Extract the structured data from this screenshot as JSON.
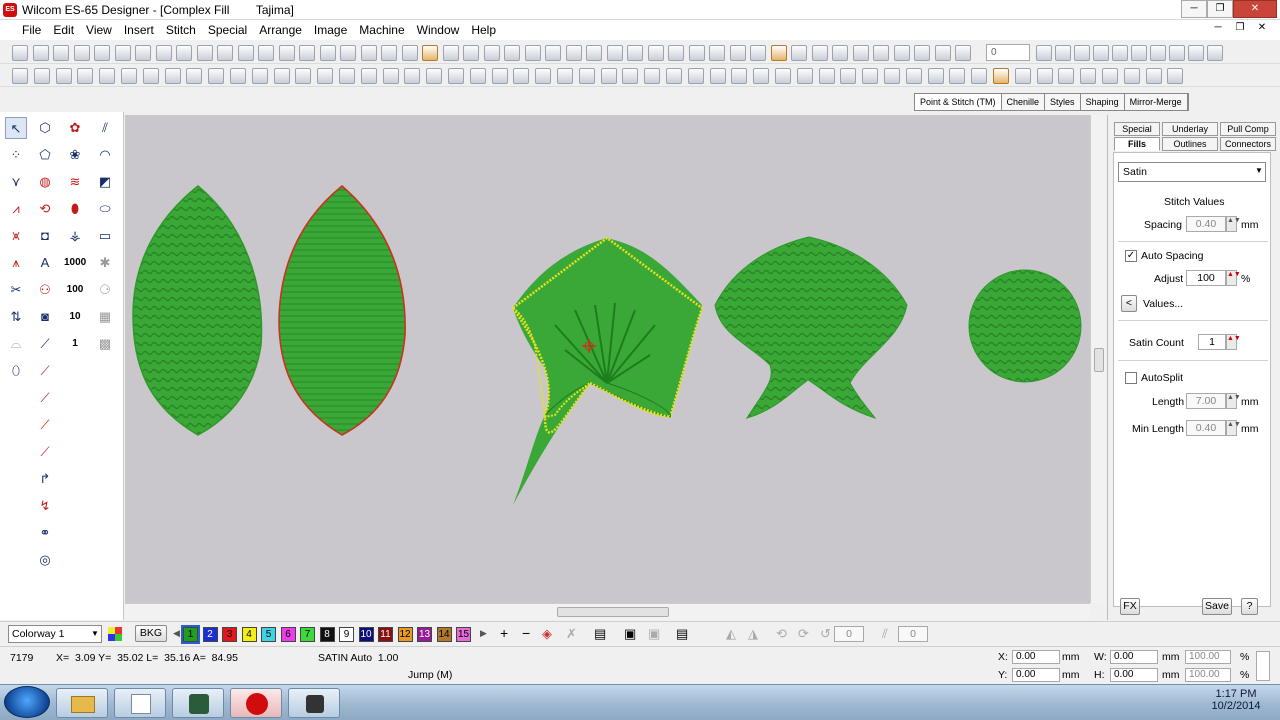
{
  "window": {
    "title": "Wilcom ES-65 Designer - [Complex Fill        Tajima]",
    "app_icon": "ES",
    "controls": [
      "─",
      "❐",
      "✕"
    ],
    "child_controls": [
      "─",
      "❐",
      "✕"
    ]
  },
  "menu": [
    "File",
    "Edit",
    "View",
    "Insert",
    "Stitch",
    "Special",
    "Arrange",
    "Image",
    "Machine",
    "Window",
    "Help"
  ],
  "toolbar": {
    "zoom_value": "0"
  },
  "top_tabs": [
    "Point & Stitch (TM)",
    "Chenille",
    "Styles",
    "Shaping",
    "Mirror-Merge"
  ],
  "toolbox_labels": {
    "t1000": "1000",
    "t100": "100",
    "t10": "10",
    "t1": "1"
  },
  "colors": {
    "fill_green": "#3aa836",
    "fill_dark": "#1d7d1c",
    "outline_red": "#c8331e",
    "outline_yellow": "#e8e21a",
    "canvas": "#c9c7cb"
  },
  "panel": {
    "tabs_row1": [
      "Special",
      "Underlay",
      "Pull Comp"
    ],
    "tabs_row2": [
      "Fills",
      "Outlines",
      "Connectors"
    ],
    "fill_type": "Satin",
    "section_title": "Stitch Values",
    "spacing_label": "Spacing",
    "spacing_value": "0.40",
    "spacing_unit": "mm",
    "auto_spacing_label": "Auto Spacing",
    "auto_spacing_checked": true,
    "adjust_label": "Adjust",
    "adjust_value": "100",
    "adjust_unit": "%",
    "values_button": "Values...",
    "satin_count_label": "Satin Count",
    "satin_count_value": "1",
    "autosplit_label": "AutoSplit",
    "autosplit_checked": false,
    "length_label": "Length",
    "length_value": "7.00",
    "length_unit": "mm",
    "min_length_label": "Min Length",
    "min_length_value": "0.40",
    "min_length_unit": "mm",
    "fx_button": "FX",
    "save_button": "Save",
    "help_button": "?"
  },
  "colorbar": {
    "colorway": "Colorway 1",
    "bkg": "BKG",
    "swatches": [
      {
        "n": "1",
        "c": "#1f9e1f"
      },
      {
        "n": "2",
        "c": "#1b2fd6"
      },
      {
        "n": "3",
        "c": "#e3171a"
      },
      {
        "n": "4",
        "c": "#f2ef12"
      },
      {
        "n": "5",
        "c": "#3fd3e6"
      },
      {
        "n": "6",
        "c": "#ea3fe8"
      },
      {
        "n": "7",
        "c": "#3cd93c"
      },
      {
        "n": "8",
        "c": "#111111"
      },
      {
        "n": "9",
        "c": "#ffffff"
      },
      {
        "n": "10",
        "c": "#0d0f7a"
      },
      {
        "n": "11",
        "c": "#8b1010"
      },
      {
        "n": "12",
        "c": "#e89b1f"
      },
      {
        "n": "13",
        "c": "#9a1b9a"
      },
      {
        "n": "14",
        "c": "#b07a2a"
      },
      {
        "n": "15",
        "c": "#e56bd6"
      }
    ],
    "angle1": "0",
    "angle2": "0"
  },
  "status": {
    "stitch_count": "7179",
    "coords": "X=  3.09 Y=  35.02 L=  35.16 A=  84.95",
    "mode": "SATIN Auto  1.00",
    "function": "Jump (M)",
    "x_label": "X:",
    "x_value": "0.00",
    "y_label": "Y:",
    "y_value": "0.00",
    "w_label": "W:",
    "w_value": "0.00",
    "h_label": "H:",
    "h_value": "0.00",
    "unit": "mm",
    "w_pct": "100.00",
    "h_pct": "100.00",
    "pct": "%"
  },
  "taskbar": {
    "time": "1:17 PM",
    "date": "10/2/2014"
  }
}
